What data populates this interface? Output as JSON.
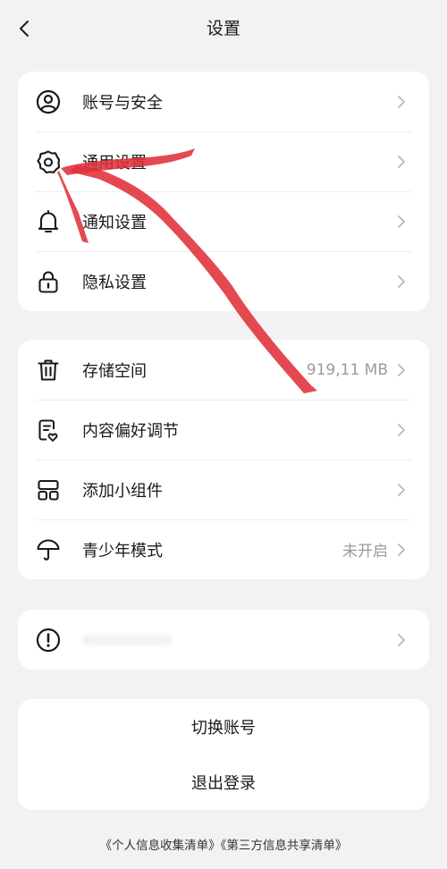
{
  "header": {
    "title": "设置",
    "back_icon": "chevron-left-icon"
  },
  "group1": [
    {
      "icon": "user-circle-icon",
      "label": "账号与安全",
      "value": ""
    },
    {
      "icon": "gear-icon",
      "label": "通用设置",
      "value": ""
    },
    {
      "icon": "bell-icon",
      "label": "通知设置",
      "value": ""
    },
    {
      "icon": "lock-icon",
      "label": "隐私设置",
      "value": ""
    }
  ],
  "group2": [
    {
      "icon": "trash-icon",
      "label": "存储空间",
      "value": "919,11 MB"
    },
    {
      "icon": "content-preference-icon",
      "label": "内容偏好调节",
      "value": ""
    },
    {
      "icon": "widgets-icon",
      "label": "添加小组件",
      "value": ""
    },
    {
      "icon": "umbrella-icon",
      "label": "青少年模式",
      "value": "未开启"
    }
  ],
  "group3": [
    {
      "icon": "info-circle-icon"
    }
  ],
  "actions": {
    "switch_account": "切换账号",
    "logout": "退出登录"
  },
  "footer": {
    "personal_info_list": "《个人信息收集清单》",
    "third_party_list": "《第三方信息共享清单》"
  },
  "colors": {
    "background": "#f2f2f4",
    "card": "#ffffff",
    "annotation_arrow": "#e0303a"
  }
}
